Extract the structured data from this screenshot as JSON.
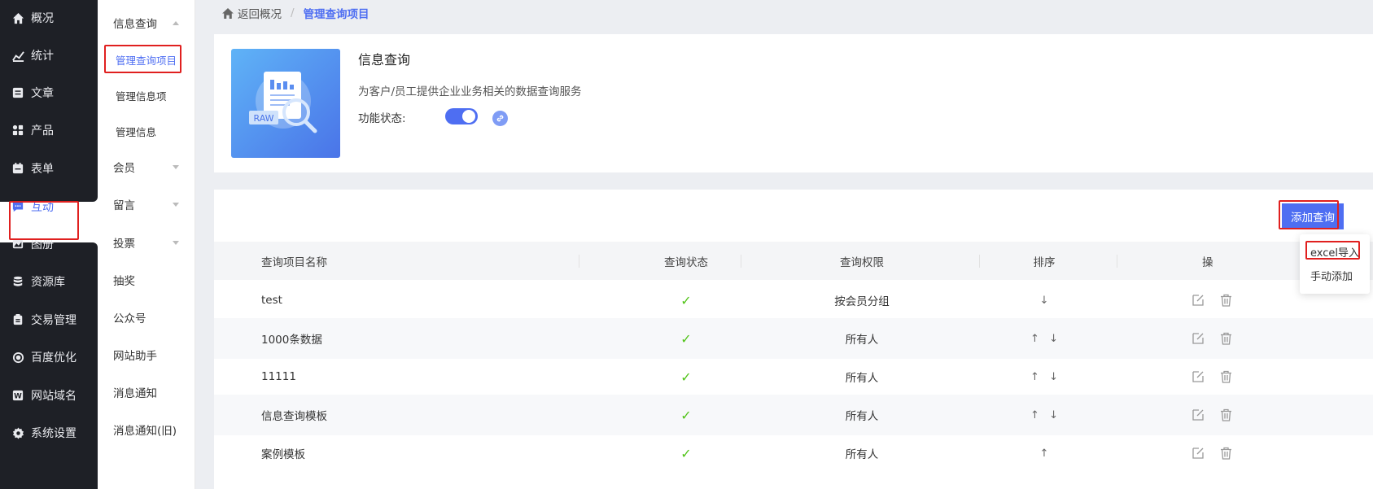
{
  "primary_nav": {
    "items": [
      {
        "label": "概况",
        "icon": "home-icon"
      },
      {
        "label": "统计",
        "icon": "stats-icon"
      },
      {
        "label": "文章",
        "icon": "article-icon"
      },
      {
        "label": "产品",
        "icon": "product-icon"
      },
      {
        "label": "表单",
        "icon": "form-icon"
      },
      {
        "label": "互动",
        "icon": "chat-icon",
        "active": true
      },
      {
        "label": "图册",
        "icon": "album-icon"
      },
      {
        "label": "资源库",
        "icon": "database-icon"
      },
      {
        "label": "交易管理",
        "icon": "clipboard-icon"
      },
      {
        "label": "百度优化",
        "icon": "seo-icon"
      },
      {
        "label": "网站域名",
        "icon": "domain-icon"
      },
      {
        "label": "系统设置",
        "icon": "gear-icon"
      }
    ]
  },
  "sub_nav": {
    "items": [
      {
        "label": "信息查询",
        "expanded": true
      },
      {
        "label": "管理查询项目",
        "active": true
      },
      {
        "label": "管理信息项"
      },
      {
        "label": "管理信息"
      },
      {
        "label": "会员"
      },
      {
        "label": "留言"
      },
      {
        "label": "投票"
      },
      {
        "label": "抽奖"
      },
      {
        "label": "公众号"
      },
      {
        "label": "网站助手"
      },
      {
        "label": "消息通知"
      },
      {
        "label": "消息通知(旧)"
      }
    ]
  },
  "breadcrumb": {
    "back": "返回概况",
    "current": "管理查询项目"
  },
  "app_info": {
    "title": "信息查询",
    "description": "为客户/员工提供企业业务相关的数据查询服务",
    "status_label": "功能状态:",
    "status_on": true,
    "thumb_badge": "RAW"
  },
  "toolbar": {
    "add_button": "添加查询",
    "dropdown": [
      "excel导入",
      "手动添加"
    ]
  },
  "table": {
    "columns": [
      "查询项目名称",
      "查询状态",
      "查询权限",
      "排序",
      "操"
    ],
    "rows": [
      {
        "name": "test",
        "status": "✓",
        "permission": "按会员分组",
        "order": [
          "↓"
        ]
      },
      {
        "name": "1000条数据",
        "status": "✓",
        "permission": "所有人",
        "order": [
          "↑",
          "↓"
        ]
      },
      {
        "name": "11111",
        "status": "✓",
        "permission": "所有人",
        "order": [
          "↑",
          "↓"
        ]
      },
      {
        "name": "信息查询模板",
        "status": "✓",
        "permission": "所有人",
        "order": [
          "↑",
          "↓"
        ]
      },
      {
        "name": "案例模板",
        "status": "✓",
        "permission": "所有人",
        "order": [
          "↑"
        ]
      }
    ]
  },
  "colors": {
    "accent": "#4e6ef2",
    "highlight": "#e0201f",
    "success": "#52c41a"
  }
}
